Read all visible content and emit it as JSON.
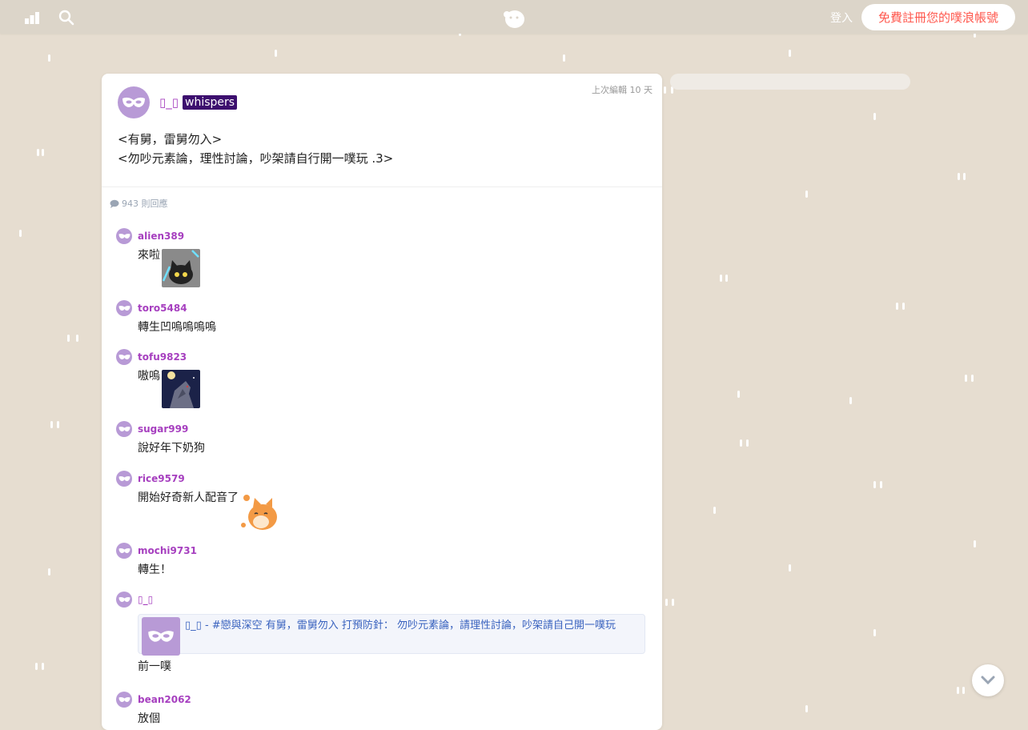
{
  "topbar": {
    "login_label": "登入",
    "signup_label": "免費註冊您的噗浪帳號"
  },
  "post": {
    "author": "▯_▯",
    "badge": "whispers",
    "edited": "上次編輯 10 天",
    "line1": "<有舅，雷舅勿入>",
    "line2": "<勿吵元素論，理性討論，吵架請自行開一噗玩 .3>",
    "reply_count": "943 則回應"
  },
  "responses": [
    {
      "user": "alien389",
      "text": "來啦",
      "emote": "black-cat-emote"
    },
    {
      "user": "toro5484",
      "text": "轉生凹嗚嗚嗚嗚"
    },
    {
      "user": "tofu9823",
      "text": "嗷嗚",
      "emote": "wolf-howl-emote"
    },
    {
      "user": "sugar999",
      "text": "說好年下奶狗"
    },
    {
      "user": "rice9579",
      "text": "開始好奇新人配音了",
      "emote": "fox-emote"
    },
    {
      "user": "mochi9731",
      "text": "轉生！"
    },
    {
      "user": "▯_▯",
      "quote": "▯_▯ - #戀與深空 有舅，雷舅勿入 打預防針： 勿吵元素論，請理性討論，吵架請自己開一噗玩",
      "text": "前一噗"
    },
    {
      "user": "bean2062",
      "text": "放個"
    }
  ],
  "colors": {
    "background": "#e6ddd0",
    "username": "#a63fbf",
    "badge_bg": "#3c0f6e",
    "signup_text": "#ff574d",
    "link": "#3a63bf"
  }
}
